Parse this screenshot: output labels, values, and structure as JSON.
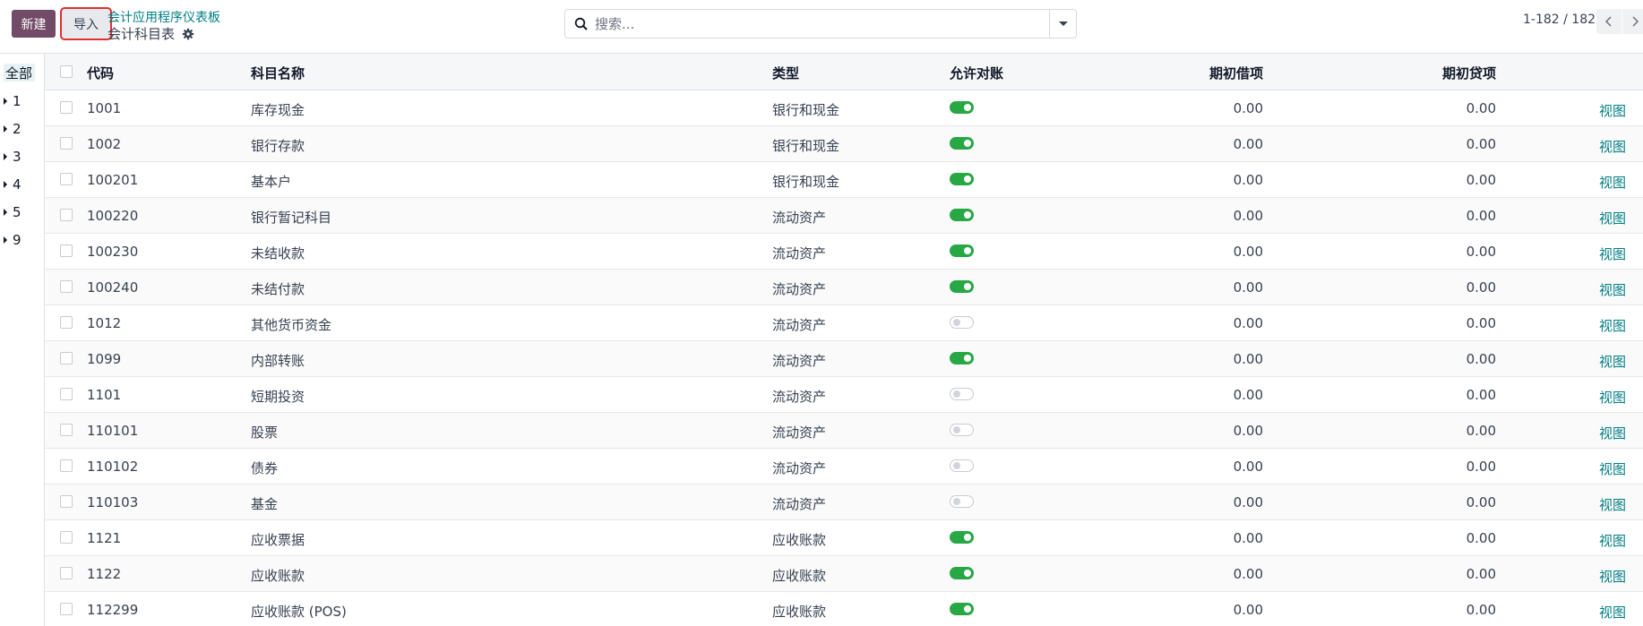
{
  "control_panel": {
    "new_label": "新建",
    "import_label": "导入",
    "breadcrumb": "会计应用程序仪表板",
    "title": "会计科目表",
    "search_placeholder": "搜索...",
    "pager": "1-182 / 182"
  },
  "side_panel": {
    "items": [
      {
        "label": "全部"
      },
      {
        "label": "1"
      },
      {
        "label": "2"
      },
      {
        "label": "3"
      },
      {
        "label": "4"
      },
      {
        "label": "5"
      },
      {
        "label": "9"
      }
    ]
  },
  "table": {
    "headers": {
      "code": "代码",
      "name": "科目名称",
      "type": "类型",
      "reconcile": "允许对账",
      "opening_debit": "期初借项",
      "opening_credit": "期初贷项"
    },
    "view_label": "视图",
    "rows": [
      {
        "code": "1001",
        "name": "库存现金",
        "type": "银行和现金",
        "reconcile": true,
        "debit": "0.00",
        "credit": "0.00"
      },
      {
        "code": "1002",
        "name": "银行存款",
        "type": "银行和现金",
        "reconcile": true,
        "debit": "0.00",
        "credit": "0.00"
      },
      {
        "code": "100201",
        "name": "基本户",
        "type": "银行和现金",
        "reconcile": true,
        "debit": "0.00",
        "credit": "0.00"
      },
      {
        "code": "100220",
        "name": "银行暂记科目",
        "type": "流动资产",
        "reconcile": true,
        "debit": "0.00",
        "credit": "0.00"
      },
      {
        "code": "100230",
        "name": "未结收款",
        "type": "流动资产",
        "reconcile": true,
        "debit": "0.00",
        "credit": "0.00"
      },
      {
        "code": "100240",
        "name": "未结付款",
        "type": "流动资产",
        "reconcile": true,
        "debit": "0.00",
        "credit": "0.00"
      },
      {
        "code": "1012",
        "name": "其他货币资金",
        "type": "流动资产",
        "reconcile": false,
        "debit": "0.00",
        "credit": "0.00"
      },
      {
        "code": "1099",
        "name": "内部转账",
        "type": "流动资产",
        "reconcile": true,
        "debit": "0.00",
        "credit": "0.00"
      },
      {
        "code": "1101",
        "name": "短期投资",
        "type": "流动资产",
        "reconcile": false,
        "debit": "0.00",
        "credit": "0.00"
      },
      {
        "code": "110101",
        "name": "股票",
        "type": "流动资产",
        "reconcile": false,
        "debit": "0.00",
        "credit": "0.00"
      },
      {
        "code": "110102",
        "name": "债券",
        "type": "流动资产",
        "reconcile": false,
        "debit": "0.00",
        "credit": "0.00"
      },
      {
        "code": "110103",
        "name": "基金",
        "type": "流动资产",
        "reconcile": false,
        "debit": "0.00",
        "credit": "0.00"
      },
      {
        "code": "1121",
        "name": "应收票据",
        "type": "应收账款",
        "reconcile": true,
        "debit": "0.00",
        "credit": "0.00"
      },
      {
        "code": "1122",
        "name": "应收账款",
        "type": "应收账款",
        "reconcile": true,
        "debit": "0.00",
        "credit": "0.00"
      },
      {
        "code": "112299",
        "name": "应收账款 (POS)",
        "type": "应收账款",
        "reconcile": true,
        "debit": "0.00",
        "credit": "0.00"
      }
    ]
  },
  "colors": {
    "brand": "#714b67",
    "link": "#017e84",
    "toggle_on": "#28a745",
    "highlight": "#e0312f"
  }
}
